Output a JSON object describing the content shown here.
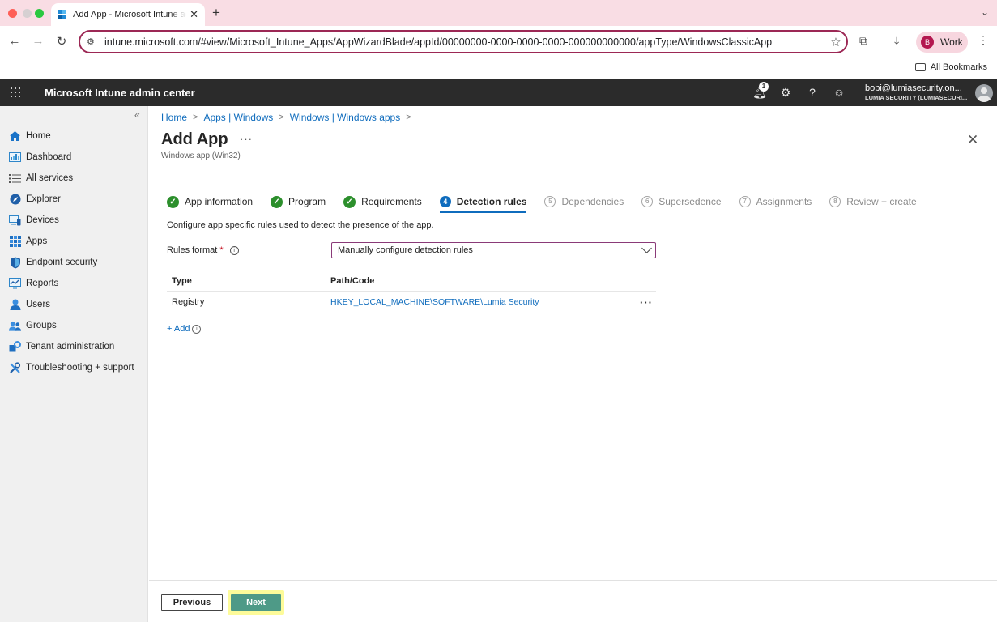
{
  "browser": {
    "tab_title": "Add App - Microsoft Intune admin center",
    "new_tab_icon": "+",
    "url": "intune.microsoft.com/#view/Microsoft_Intune_Apps/AppWizardBlade/appId/00000000-0000-0000-0000-000000000000/appType/WindowsClassicApp",
    "profile_initial": "B",
    "profile_label": "Work",
    "bookmarks_label": "All Bookmarks"
  },
  "portal": {
    "title": "Microsoft Intune admin center",
    "notification_count": "1",
    "account_email": "bobi@lumiasecurity.on...",
    "account_tenant": "LUMIA SECURITY (LUMIASECURI..."
  },
  "sidebar": {
    "collapse_icon": "«",
    "items": [
      {
        "label": "Home",
        "icon": "home-icon"
      },
      {
        "label": "Dashboard",
        "icon": "dashboard-icon"
      },
      {
        "label": "All services",
        "icon": "list-icon"
      },
      {
        "label": "Explorer",
        "icon": "explorer-icon"
      },
      {
        "label": "Devices",
        "icon": "devices-icon"
      },
      {
        "label": "Apps",
        "icon": "apps-icon"
      },
      {
        "label": "Endpoint security",
        "icon": "shield-icon"
      },
      {
        "label": "Reports",
        "icon": "reports-icon"
      },
      {
        "label": "Users",
        "icon": "user-icon"
      },
      {
        "label": "Groups",
        "icon": "groups-icon"
      },
      {
        "label": "Tenant administration",
        "icon": "tenant-admin-icon"
      },
      {
        "label": "Troubleshooting + support",
        "icon": "troubleshoot-icon"
      }
    ]
  },
  "breadcrumb": [
    "Home",
    "Apps | Windows",
    "Windows | Windows apps"
  ],
  "page": {
    "title": "Add App",
    "more": "···",
    "subtitle": "Windows app (Win32)"
  },
  "steps": [
    {
      "number": "1",
      "label": "App information",
      "state": "done"
    },
    {
      "number": "2",
      "label": "Program",
      "state": "done"
    },
    {
      "number": "3",
      "label": "Requirements",
      "state": "done"
    },
    {
      "number": "4",
      "label": "Detection rules",
      "state": "current"
    },
    {
      "number": "5",
      "label": "Dependencies",
      "state": "pending"
    },
    {
      "number": "6",
      "label": "Supersedence",
      "state": "pending"
    },
    {
      "number": "7",
      "label": "Assignments",
      "state": "pending"
    },
    {
      "number": "8",
      "label": "Review + create",
      "state": "pending"
    }
  ],
  "form": {
    "intro": "Configure app specific rules used to detect the presence of the app.",
    "rules_format_label": "Rules format",
    "required_marker": "*",
    "rules_format_value": "Manually configure detection rules",
    "table_headers": [
      "Type",
      "Path/Code"
    ],
    "rows": [
      {
        "type": "Registry",
        "path": "HKEY_LOCAL_MACHINE\\SOFTWARE\\Lumia Security"
      }
    ],
    "row_more": "···",
    "add_label": "+ Add"
  },
  "footer": {
    "previous_label": "Previous",
    "next_label": "Next"
  },
  "colors": {
    "accent": "#0f6cbd",
    "complete": "#2c8f2c",
    "next_button": "#4e9a87",
    "highlight": "#fdfb9a",
    "header_bg": "#2b2b2b"
  }
}
